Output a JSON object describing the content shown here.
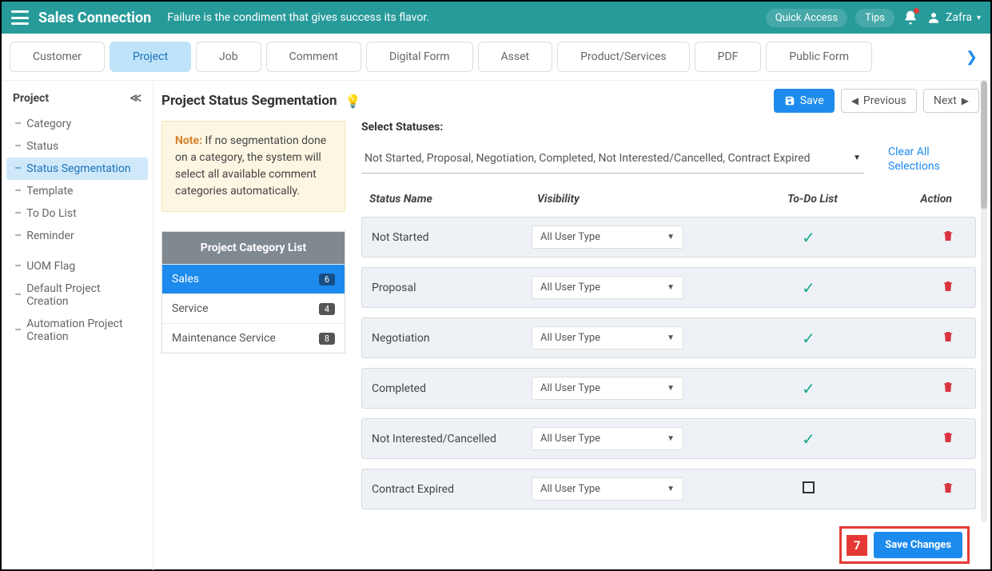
{
  "topbar": {
    "brand": "Sales Connection",
    "motto": "Failure is the condiment that gives success its flavor.",
    "quick_access": "Quick Access",
    "tips": "Tips",
    "user": "Zafra"
  },
  "tabs": {
    "items": [
      "Customer",
      "Project",
      "Job",
      "Comment",
      "Digital Form",
      "Asset",
      "Product/Services",
      "PDF",
      "Public Form"
    ],
    "active_index": 1
  },
  "sidebar": {
    "title": "Project",
    "group1": [
      {
        "label": "Category"
      },
      {
        "label": "Status"
      },
      {
        "label": "Status Segmentation",
        "active": true
      },
      {
        "label": "Template"
      },
      {
        "label": "To Do List"
      },
      {
        "label": "Reminder"
      }
    ],
    "group2": [
      {
        "label": "UOM Flag"
      },
      {
        "label": "Default Project Creation"
      },
      {
        "label": "Automation Project Creation"
      }
    ]
  },
  "page": {
    "title": "Project Status Segmentation",
    "save": "Save",
    "prev": "Previous",
    "next": "Next"
  },
  "note": {
    "prefix": "Note:",
    "text": " If no segmentation done on a category, the system will select all available comment categories automatically."
  },
  "categoryList": {
    "title": "Project Category List",
    "items": [
      {
        "name": "Sales",
        "count": "6",
        "active": true
      },
      {
        "name": "Service",
        "count": "4"
      },
      {
        "name": "Maintenance Service",
        "count": "8"
      }
    ]
  },
  "selectStatuses": {
    "label": "Select Statuses:",
    "value": "Not Started, Proposal, Negotiation, Completed, Not Interested/Cancelled, Contract Expired",
    "clear": "Clear All Selections"
  },
  "table": {
    "headers": {
      "name": "Status Name",
      "visibility": "Visibility",
      "todo": "To-Do List",
      "action": "Action"
    },
    "vis_option": "All User Type",
    "rows": [
      {
        "name": "Not Started",
        "todo_checked": true
      },
      {
        "name": "Proposal",
        "todo_checked": true
      },
      {
        "name": "Negotiation",
        "todo_checked": true
      },
      {
        "name": "Completed",
        "todo_checked": true
      },
      {
        "name": "Not Interested/Cancelled",
        "todo_checked": true
      },
      {
        "name": "Contract Expired",
        "todo_checked": false
      }
    ]
  },
  "callout": {
    "num": "7",
    "button": "Save Changes"
  }
}
